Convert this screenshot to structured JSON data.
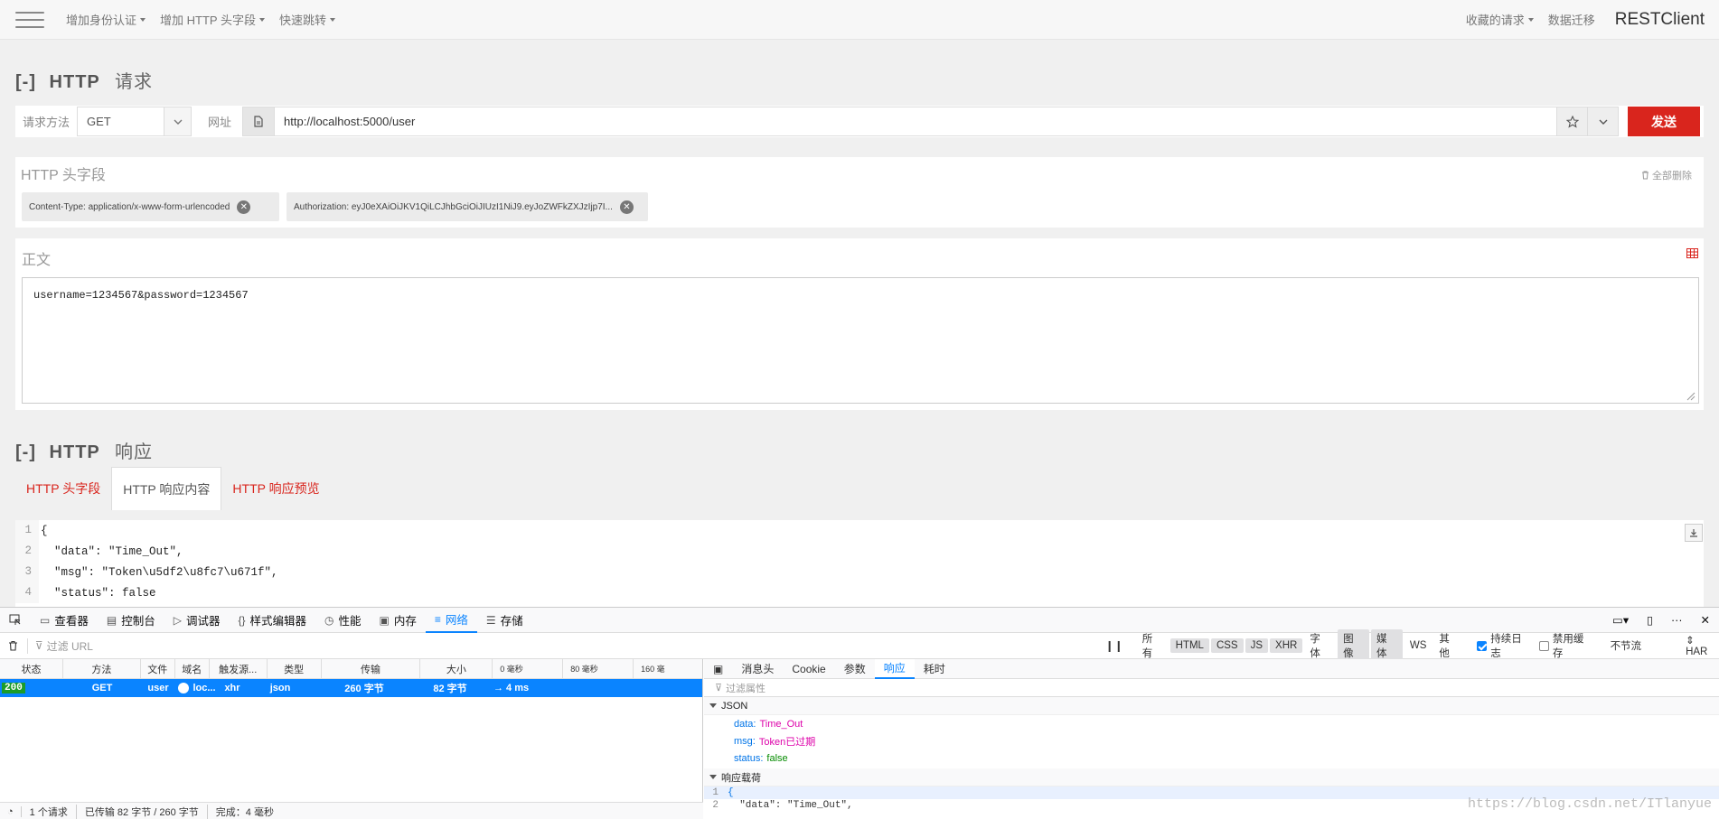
{
  "navbar": {
    "items": [
      {
        "label": "增加身份认证"
      },
      {
        "label": "增加 HTTP 头字段"
      },
      {
        "label": "快速跳转"
      }
    ],
    "right_items": [
      {
        "label": "收藏的请求"
      },
      {
        "label": "数据迁移"
      }
    ],
    "brand": "RESTClient"
  },
  "request": {
    "title_bracket": "[-]",
    "title_main": "HTTP",
    "title_cn": "请求",
    "method_label": "请求方法",
    "method_value": "GET",
    "url_label": "网址",
    "url_value": "http://localhost:5000/user",
    "send_label": "发送"
  },
  "headers": {
    "title": "HTTP 头字段",
    "clear_all": "全部删除",
    "chips": [
      {
        "text": "Content-Type: application/x-www-form-urlencoded"
      },
      {
        "text": "Authorization: eyJ0eXAiOiJKV1QiLCJhbGciOiJIUzI1NiJ9.eyJoZWFkZXJzIjp7I..."
      }
    ]
  },
  "body": {
    "title": "正文",
    "value": "username=1234567&password=1234567"
  },
  "response": {
    "title_bracket": "[-]",
    "title_main": "HTTP",
    "title_cn": "响应",
    "tabs": [
      {
        "label": "HTTP 头字段"
      },
      {
        "label": "HTTP 响应内容"
      },
      {
        "label": "HTTP 响应预览"
      }
    ],
    "code_lines": [
      {
        "n": "1",
        "text": "{"
      },
      {
        "n": "2",
        "text": "  \"data\": \"Time_Out\","
      },
      {
        "n": "3",
        "text": "  \"msg\": \"Token\\u5df2\\u8fc7\\u671f\","
      },
      {
        "n": "4",
        "text": "  \"status\": false"
      }
    ]
  },
  "devtools": {
    "tabs": [
      {
        "label": "查看器",
        "icon": "inspector-icon"
      },
      {
        "label": "控制台",
        "icon": "console-icon"
      },
      {
        "label": "调试器",
        "icon": "debugger-icon"
      },
      {
        "label": "样式编辑器",
        "icon": "style-editor-icon"
      },
      {
        "label": "性能",
        "icon": "performance-icon"
      },
      {
        "label": "内存",
        "icon": "memory-icon"
      },
      {
        "label": "网络",
        "icon": "network-icon"
      },
      {
        "label": "存储",
        "icon": "storage-icon"
      }
    ],
    "filter_placeholder": "过滤 URL",
    "type_filters": [
      "所有",
      "HTML",
      "CSS",
      "JS",
      "XHR",
      "字体",
      "图像",
      "媒体",
      "WS",
      "其他"
    ],
    "persist_log": "持续日志",
    "disable_cache": "禁用缓存",
    "throttle": "不节流",
    "har": "HAR",
    "columns": [
      "状态",
      "方法",
      "文件",
      "域名",
      "触发源...",
      "类型",
      "传输",
      "大小",
      "0 毫秒",
      "80 毫秒",
      "160 毫"
    ],
    "row": {
      "status": "200",
      "method": "GET",
      "file": "user",
      "domain": "loc...",
      "cause": "xhr",
      "type": "json",
      "transferred": "260 字节",
      "size": "82 字节",
      "timing": "→ 4 ms"
    },
    "footer": {
      "requests": "1 个请求",
      "transferred": "已传输 82 字节 / 260 字节",
      "finish": "完成：4 毫秒"
    },
    "detail_tabs": [
      "消息头",
      "Cookie",
      "参数",
      "响应",
      "耗时"
    ],
    "detail_filter": "过滤属性",
    "json_section": "JSON",
    "props": [
      {
        "k": "data:",
        "v": "Time_Out",
        "kind": "str"
      },
      {
        "k": "msg:",
        "v": "Token已过期",
        "kind": "str"
      },
      {
        "k": "status:",
        "v": "false",
        "kind": "bool"
      }
    ],
    "payload_section": "响应载荷",
    "payload_lines": [
      {
        "n": "1",
        "text": "{"
      },
      {
        "n": "2",
        "text": "  \"data\": \"Time_Out\","
      }
    ]
  },
  "watermark": "https://blog.csdn.net/ITlanyue"
}
